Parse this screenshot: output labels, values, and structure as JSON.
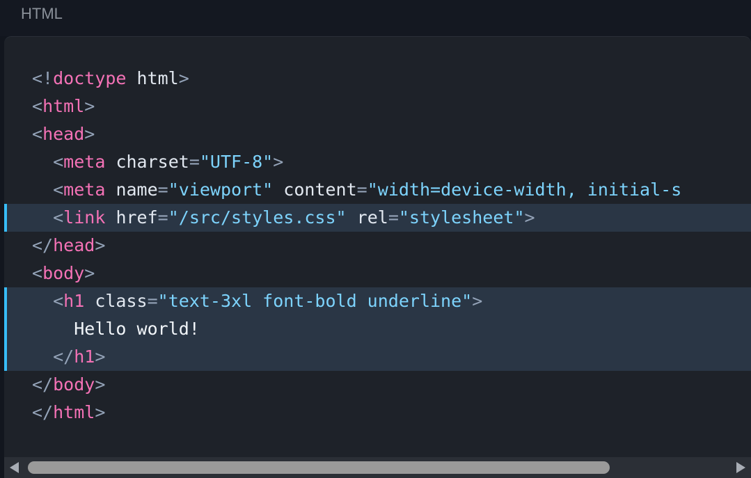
{
  "tab": {
    "label": "HTML"
  },
  "code": {
    "lines": [
      {
        "highlighted": false,
        "tokens": [
          {
            "t": "<!",
            "c": "punct"
          },
          {
            "t": "doctype",
            "c": "tag"
          },
          {
            "t": " html",
            "c": "attr"
          },
          {
            "t": ">",
            "c": "punct"
          }
        ]
      },
      {
        "highlighted": false,
        "tokens": [
          {
            "t": "<",
            "c": "punct"
          },
          {
            "t": "html",
            "c": "tag"
          },
          {
            "t": ">",
            "c": "punct"
          }
        ]
      },
      {
        "highlighted": false,
        "tokens": [
          {
            "t": "<",
            "c": "punct"
          },
          {
            "t": "head",
            "c": "tag"
          },
          {
            "t": ">",
            "c": "punct"
          }
        ]
      },
      {
        "highlighted": false,
        "tokens": [
          {
            "t": "  ",
            "c": "txt"
          },
          {
            "t": "<",
            "c": "punct"
          },
          {
            "t": "meta",
            "c": "tag"
          },
          {
            "t": " charset",
            "c": "attr"
          },
          {
            "t": "=",
            "c": "punct"
          },
          {
            "t": "\"UTF-8\"",
            "c": "str"
          },
          {
            "t": ">",
            "c": "punct"
          }
        ]
      },
      {
        "highlighted": false,
        "tokens": [
          {
            "t": "  ",
            "c": "txt"
          },
          {
            "t": "<",
            "c": "punct"
          },
          {
            "t": "meta",
            "c": "tag"
          },
          {
            "t": " name",
            "c": "attr"
          },
          {
            "t": "=",
            "c": "punct"
          },
          {
            "t": "\"viewport\"",
            "c": "str"
          },
          {
            "t": " content",
            "c": "attr"
          },
          {
            "t": "=",
            "c": "punct"
          },
          {
            "t": "\"width=device-width, initial-s",
            "c": "str"
          }
        ]
      },
      {
        "highlighted": true,
        "tokens": [
          {
            "t": "  ",
            "c": "txt"
          },
          {
            "t": "<",
            "c": "punct"
          },
          {
            "t": "link",
            "c": "tag"
          },
          {
            "t": " href",
            "c": "attr"
          },
          {
            "t": "=",
            "c": "punct"
          },
          {
            "t": "\"/src/styles.css\"",
            "c": "str"
          },
          {
            "t": " rel",
            "c": "attr"
          },
          {
            "t": "=",
            "c": "punct"
          },
          {
            "t": "\"stylesheet\"",
            "c": "str"
          },
          {
            "t": ">",
            "c": "punct"
          }
        ]
      },
      {
        "highlighted": false,
        "tokens": [
          {
            "t": "</",
            "c": "punct"
          },
          {
            "t": "head",
            "c": "tag"
          },
          {
            "t": ">",
            "c": "punct"
          }
        ]
      },
      {
        "highlighted": false,
        "tokens": [
          {
            "t": "<",
            "c": "punct"
          },
          {
            "t": "body",
            "c": "tag"
          },
          {
            "t": ">",
            "c": "punct"
          }
        ]
      },
      {
        "highlighted": true,
        "tokens": [
          {
            "t": "  ",
            "c": "txt"
          },
          {
            "t": "<",
            "c": "punct"
          },
          {
            "t": "h1",
            "c": "tag"
          },
          {
            "t": " class",
            "c": "attr"
          },
          {
            "t": "=",
            "c": "punct"
          },
          {
            "t": "\"text-3xl font-bold underline\"",
            "c": "str"
          },
          {
            "t": ">",
            "c": "punct"
          }
        ]
      },
      {
        "highlighted": true,
        "tokens": [
          {
            "t": "    ",
            "c": "txt"
          },
          {
            "t": "Hello world!",
            "c": "txt"
          }
        ]
      },
      {
        "highlighted": true,
        "tokens": [
          {
            "t": "  ",
            "c": "txt"
          },
          {
            "t": "</",
            "c": "punct"
          },
          {
            "t": "h1",
            "c": "tag"
          },
          {
            "t": ">",
            "c": "punct"
          }
        ]
      },
      {
        "highlighted": false,
        "tokens": [
          {
            "t": "</",
            "c": "punct"
          },
          {
            "t": "body",
            "c": "tag"
          },
          {
            "t": ">",
            "c": "punct"
          }
        ]
      },
      {
        "highlighted": false,
        "tokens": [
          {
            "t": "</",
            "c": "punct"
          },
          {
            "t": "html",
            "c": "tag"
          },
          {
            "t": ">",
            "c": "punct"
          }
        ]
      }
    ]
  },
  "scrollbar": {
    "position_fraction": 0.0,
    "visible_fraction": 0.81
  },
  "colors": {
    "tag": "#f472b6",
    "string": "#7dd3fc",
    "punctuation": "#94a3b8",
    "highlight_bg": "#2a3645",
    "highlight_bar": "#38bdf8"
  },
  "icons": {
    "scroll_left": "triangle-left-icon",
    "scroll_right": "triangle-right-icon"
  }
}
